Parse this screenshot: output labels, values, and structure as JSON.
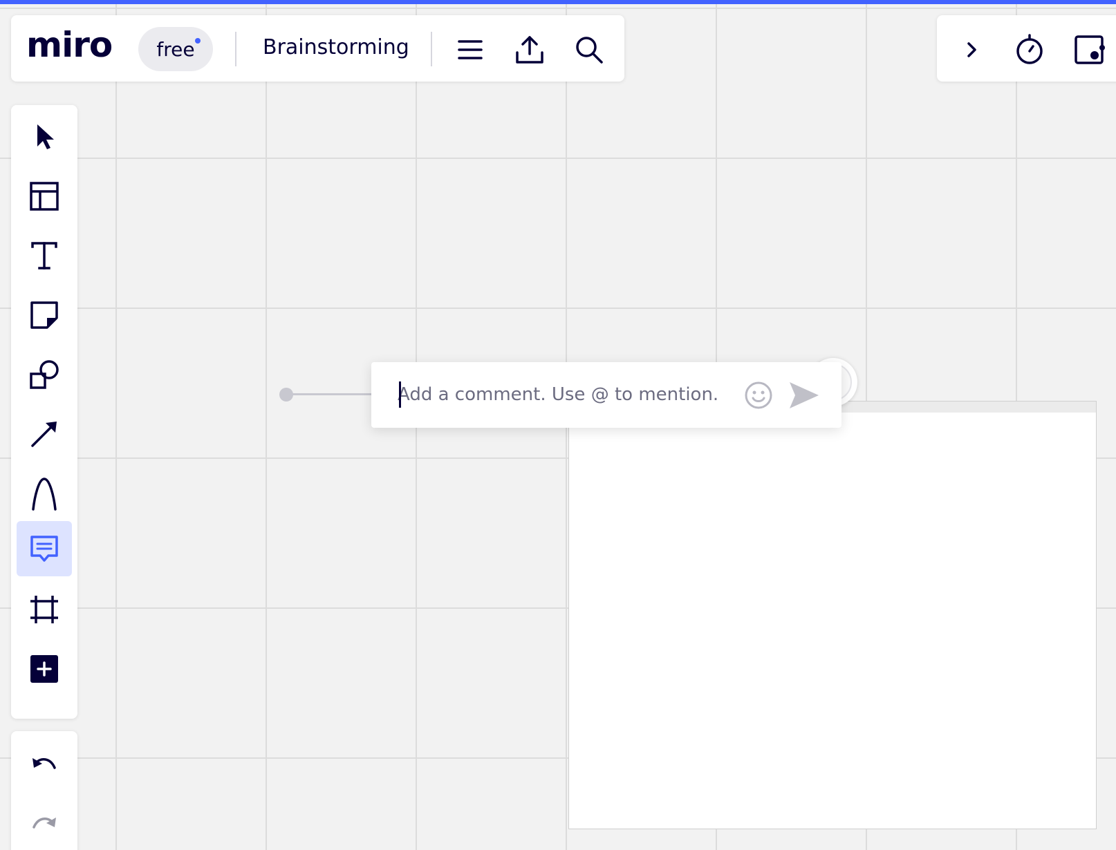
{
  "app": {
    "logo_text": "miro",
    "plan_badge": "free",
    "board_title": "Brainstorming",
    "accent_color": "#4262ff",
    "ink_color": "#050038"
  },
  "toolbar": {
    "buttons": [
      "menu-icon",
      "export-icon",
      "search-icon"
    ]
  },
  "right_toolbar": {
    "buttons": [
      "chevron-right-icon",
      "timer-icon",
      "presentation-icon"
    ]
  },
  "left_tools": [
    {
      "name": "select",
      "icon": "pointer-icon",
      "active": false
    },
    {
      "name": "templates",
      "icon": "templates-icon",
      "active": false
    },
    {
      "name": "text",
      "icon": "text-icon",
      "active": false
    },
    {
      "name": "sticky-note",
      "icon": "sticky-note-icon",
      "active": false
    },
    {
      "name": "shapes",
      "icon": "shapes-icon",
      "active": false
    },
    {
      "name": "connection-line",
      "icon": "arrow-icon",
      "active": false
    },
    {
      "name": "pen",
      "icon": "pen-icon",
      "active": false
    },
    {
      "name": "comment",
      "icon": "comment-icon",
      "active": true
    },
    {
      "name": "frame",
      "icon": "frame-icon",
      "active": false
    },
    {
      "name": "more-apps",
      "icon": "plus-icon",
      "active": false
    }
  ],
  "history": {
    "buttons": [
      "undo-icon",
      "redo-icon"
    ]
  },
  "comment": {
    "placeholder": "Add a comment. Use @ to mention.",
    "value": ""
  }
}
